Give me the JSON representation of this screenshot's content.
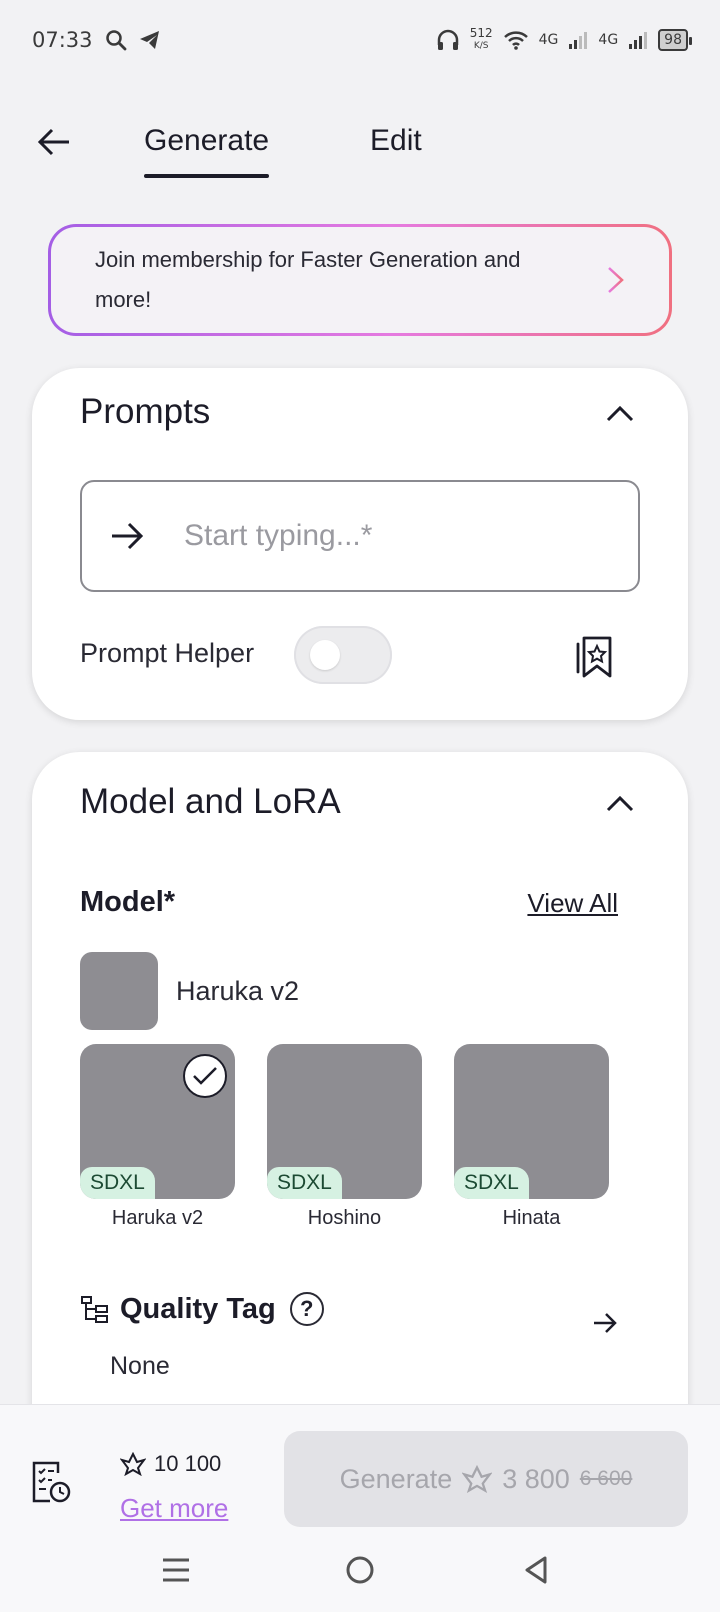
{
  "status_bar": {
    "time": "07:33",
    "net_speed": "512",
    "net_unit": "K/S",
    "signal1": "4G",
    "signal2": "4G",
    "battery": "98"
  },
  "nav": {
    "tabs": [
      {
        "label": "Generate",
        "active": true
      },
      {
        "label": "Edit",
        "active": false
      }
    ]
  },
  "membership": {
    "text": "Join membership for Faster Generation and more!"
  },
  "prompts": {
    "title": "Prompts",
    "input_value": "",
    "input_placeholder": "Start typing...*",
    "helper_label": "Prompt Helper",
    "helper_enabled": false
  },
  "model_section": {
    "title": "Model and LoRA",
    "model_label": "Model*",
    "view_all": "View All",
    "selected_model": "Haruka v2",
    "models": [
      {
        "name": "Haruka v2",
        "badge": "SDXL",
        "selected": true
      },
      {
        "name": "Hoshino",
        "badge": "SDXL",
        "selected": false
      },
      {
        "name": "Hinata",
        "badge": "SDXL",
        "selected": false
      }
    ],
    "quality_tag_label": "Quality Tag",
    "quality_tag_value": "None"
  },
  "bottom": {
    "credits": "10 100",
    "get_more": "Get more",
    "generate_label": "Generate",
    "generate_cost": "3 800",
    "generate_old_cost": "6 600"
  },
  "colors": {
    "accent_gradient_start": "#a45ee5",
    "accent_gradient_end": "#f07080",
    "badge_bg": "#d6f1e2",
    "thumb_placeholder": "#8e8d92"
  }
}
